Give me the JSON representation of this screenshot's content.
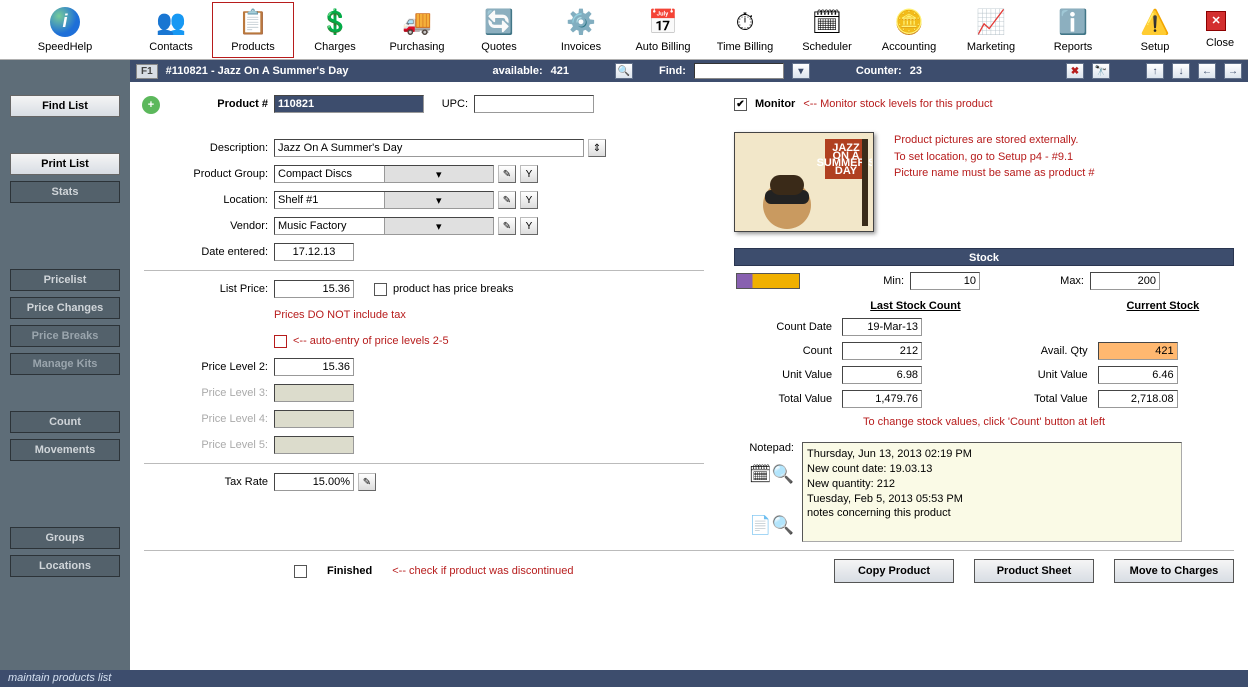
{
  "speedhelp_label": "SpeedHelp",
  "toolbar": [
    {
      "id": "contacts",
      "label": "Contacts",
      "glyph": "👥"
    },
    {
      "id": "products",
      "label": "Products",
      "glyph": "📋",
      "selected": true
    },
    {
      "id": "charges",
      "label": "Charges",
      "glyph": "💲"
    },
    {
      "id": "purchasing",
      "label": "Purchasing",
      "glyph": "🚚"
    },
    {
      "id": "quotes",
      "label": "Quotes",
      "glyph": "🔄"
    },
    {
      "id": "invoices",
      "label": "Invoices",
      "glyph": "⚙️"
    },
    {
      "id": "autobilling",
      "label": "Auto Billing",
      "glyph": "📅"
    },
    {
      "id": "timebilling",
      "label": "Time Billing",
      "glyph": "⏱"
    },
    {
      "id": "scheduler",
      "label": "Scheduler",
      "glyph": "🗓"
    },
    {
      "id": "accounting",
      "label": "Accounting",
      "glyph": "🪙"
    },
    {
      "id": "marketing",
      "label": "Marketing",
      "glyph": "📈"
    },
    {
      "id": "reports",
      "label": "Reports",
      "glyph": "ℹ️"
    },
    {
      "id": "setup",
      "label": "Setup",
      "glyph": "⚠️"
    },
    {
      "id": "close",
      "label": "Close",
      "glyph": "✕",
      "isclose": true
    }
  ],
  "header": {
    "f": "F1",
    "title": "#110821 - Jazz On A Summer's Day",
    "available_label": "available:",
    "available_value": "421",
    "find_label": "Find:",
    "counter_label": "Counter:",
    "counter_value": "23"
  },
  "sidebar": {
    "findlist": "Find List",
    "printlist": "Print List",
    "stats": "Stats",
    "pricelist": "Pricelist",
    "pricechanges": "Price Changes",
    "pricebreaks": "Price Breaks",
    "managekits": "Manage Kits",
    "count": "Count",
    "movements": "Movements",
    "groups": "Groups",
    "locations": "Locations"
  },
  "labels": {
    "productnum": "Product #",
    "upc": "UPC:",
    "monitor": "Monitor",
    "monitor_hint": "<-- Monitor stock levels for this product",
    "description": "Description:",
    "productgroup": "Product Group:",
    "location": "Location:",
    "vendor": "Vendor:",
    "dateentered": "Date entered:",
    "listprice": "List Price:",
    "hasbreaks": "product has price breaks",
    "taxincl": "Prices DO NOT include tax",
    "autoentry": "<-- auto-entry of price levels 2-5",
    "pl2": "Price Level 2:",
    "pl3": "Price Level 3:",
    "pl4": "Price Level 4:",
    "pl5": "Price Level 5:",
    "taxrate": "Tax Rate",
    "finished": "Finished",
    "finished_hint": "<-- check if product was discontinued",
    "picnote1": "Product pictures are stored externally.",
    "picnote2": "To set location, go to Setup p4 - #9.1",
    "picnote3": "Picture name must be same as product #",
    "stock": "Stock",
    "min": "Min:",
    "max": "Max:",
    "lastcount": "Last Stock Count",
    "currentstock": "Current Stock",
    "countdate": "Count Date",
    "count": "Count",
    "unitvalue": "Unit Value",
    "totalvalue": "Total Value",
    "availqty": "Avail. Qty",
    "stocknote": "To change stock values, click 'Count' button at left",
    "notepad": "Notepad:",
    "copyproduct": "Copy Product",
    "productsheet": "Product Sheet",
    "movetocharges": "Move to Charges"
  },
  "product": {
    "number": "110821",
    "upc": "",
    "monitor": true,
    "description": "Jazz On A Summer's Day",
    "group": "Compact Discs",
    "location": "Shelf #1",
    "vendor": "Music Factory",
    "date_entered": "17.12.13",
    "list_price": "15.36",
    "has_breaks": false,
    "auto_entry": false,
    "price_level2": "15.36",
    "price_level3": "",
    "price_level4": "",
    "price_level5": "",
    "tax_rate": "15.00%",
    "finished": false
  },
  "stock": {
    "min": "10",
    "max": "200",
    "count_date": "19-Mar-13",
    "count": "212",
    "last_unit_value": "6.98",
    "last_total_value": "1,479.76",
    "avail_qty": "421",
    "cur_unit_value": "6.46",
    "cur_total_value": "2,718.08"
  },
  "notepad": "Thursday, Jun 13, 2013  02:19 PM\nNew count date: 19.03.13\nNew quantity: 212\nTuesday, Feb 5, 2013  05:53 PM\nnotes concerning this product",
  "footer": "maintain products list"
}
